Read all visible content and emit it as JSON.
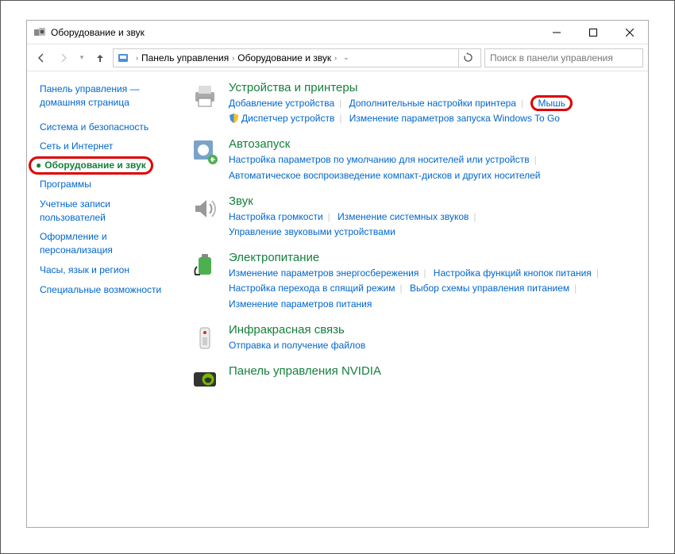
{
  "window": {
    "title": "Оборудование и звук"
  },
  "breadcrumb": {
    "item1": "Панель управления",
    "item2": "Оборудование и звук"
  },
  "search": {
    "placeholder": "Поиск в панели управления"
  },
  "sidebar": {
    "home": "Панель управления — домашняя страница",
    "items": [
      "Система и безопасность",
      "Сеть и Интернет",
      "Оборудование и звук",
      "Программы",
      "Учетные записи пользователей",
      "Оформление и персонализация",
      "Часы, язык и регион",
      "Специальные возможности"
    ]
  },
  "categories": [
    {
      "title": "Устройства и принтеры",
      "links": [
        "Добавление устройства",
        "Дополнительные настройки принтера",
        "Мышь",
        "Диспетчер устройств",
        "Изменение параметров запуска Windows To Go"
      ],
      "shield_idx": 3
    },
    {
      "title": "Автозапуск",
      "links": [
        "Настройка параметров по умолчанию для носителей или устройств",
        "Автоматическое воспроизведение компакт-дисков и других носителей"
      ]
    },
    {
      "title": "Звук",
      "links": [
        "Настройка громкости",
        "Изменение системных звуков",
        "Управление звуковыми устройствами"
      ]
    },
    {
      "title": "Электропитание",
      "links": [
        "Изменение параметров энергосбережения",
        "Настройка функций кнопок питания",
        "Настройка перехода в спящий режим",
        "Выбор схемы управления питанием",
        "Изменение параметров питания"
      ]
    },
    {
      "title": "Инфракрасная связь",
      "links": [
        "Отправка и получение файлов"
      ]
    },
    {
      "title": "Панель управления NVIDIA",
      "links": []
    }
  ]
}
